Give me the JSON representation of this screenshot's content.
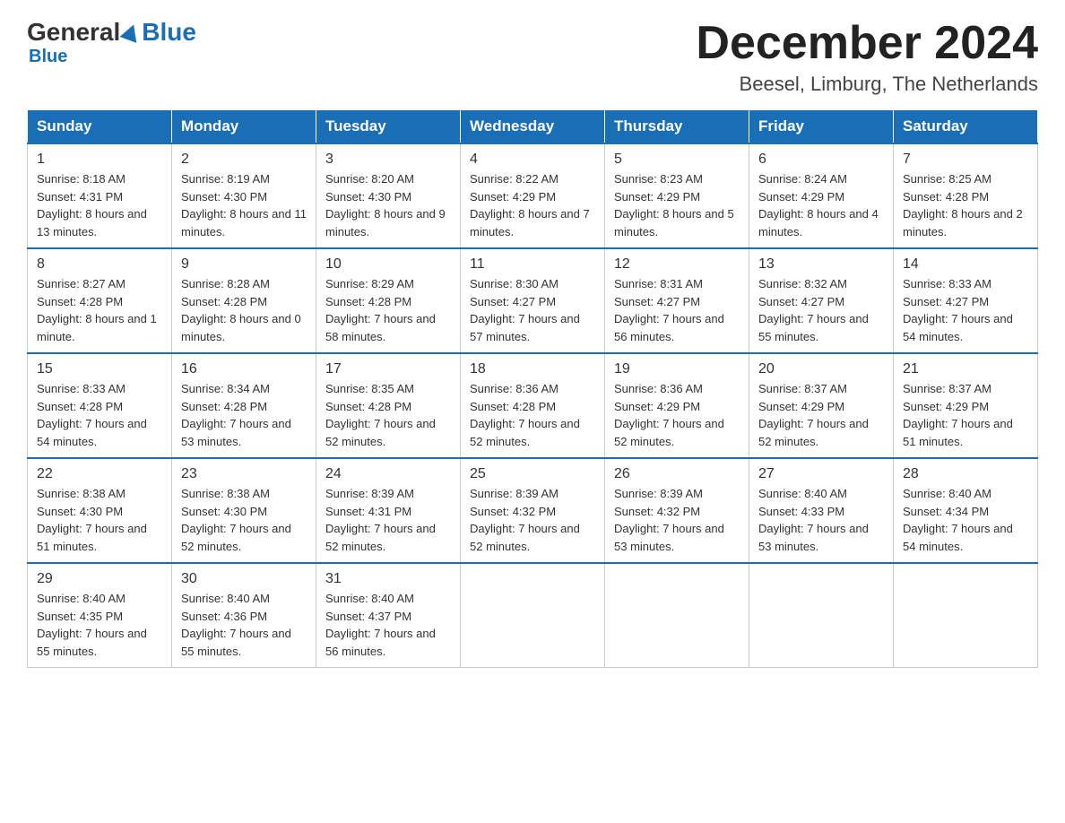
{
  "logo": {
    "general": "General",
    "blue": "Blue"
  },
  "header": {
    "month": "December 2024",
    "location": "Beesel, Limburg, The Netherlands"
  },
  "days_of_week": [
    "Sunday",
    "Monday",
    "Tuesday",
    "Wednesday",
    "Thursday",
    "Friday",
    "Saturday"
  ],
  "weeks": [
    [
      {
        "day": "1",
        "sunrise": "8:18 AM",
        "sunset": "4:31 PM",
        "daylight": "8 hours and 13 minutes."
      },
      {
        "day": "2",
        "sunrise": "8:19 AM",
        "sunset": "4:30 PM",
        "daylight": "8 hours and 11 minutes."
      },
      {
        "day": "3",
        "sunrise": "8:20 AM",
        "sunset": "4:30 PM",
        "daylight": "8 hours and 9 minutes."
      },
      {
        "day": "4",
        "sunrise": "8:22 AM",
        "sunset": "4:29 PM",
        "daylight": "8 hours and 7 minutes."
      },
      {
        "day": "5",
        "sunrise": "8:23 AM",
        "sunset": "4:29 PM",
        "daylight": "8 hours and 5 minutes."
      },
      {
        "day": "6",
        "sunrise": "8:24 AM",
        "sunset": "4:29 PM",
        "daylight": "8 hours and 4 minutes."
      },
      {
        "day": "7",
        "sunrise": "8:25 AM",
        "sunset": "4:28 PM",
        "daylight": "8 hours and 2 minutes."
      }
    ],
    [
      {
        "day": "8",
        "sunrise": "8:27 AM",
        "sunset": "4:28 PM",
        "daylight": "8 hours and 1 minute."
      },
      {
        "day": "9",
        "sunrise": "8:28 AM",
        "sunset": "4:28 PM",
        "daylight": "8 hours and 0 minutes."
      },
      {
        "day": "10",
        "sunrise": "8:29 AM",
        "sunset": "4:28 PM",
        "daylight": "7 hours and 58 minutes."
      },
      {
        "day": "11",
        "sunrise": "8:30 AM",
        "sunset": "4:27 PM",
        "daylight": "7 hours and 57 minutes."
      },
      {
        "day": "12",
        "sunrise": "8:31 AM",
        "sunset": "4:27 PM",
        "daylight": "7 hours and 56 minutes."
      },
      {
        "day": "13",
        "sunrise": "8:32 AM",
        "sunset": "4:27 PM",
        "daylight": "7 hours and 55 minutes."
      },
      {
        "day": "14",
        "sunrise": "8:33 AM",
        "sunset": "4:27 PM",
        "daylight": "7 hours and 54 minutes."
      }
    ],
    [
      {
        "day": "15",
        "sunrise": "8:33 AM",
        "sunset": "4:28 PM",
        "daylight": "7 hours and 54 minutes."
      },
      {
        "day": "16",
        "sunrise": "8:34 AM",
        "sunset": "4:28 PM",
        "daylight": "7 hours and 53 minutes."
      },
      {
        "day": "17",
        "sunrise": "8:35 AM",
        "sunset": "4:28 PM",
        "daylight": "7 hours and 52 minutes."
      },
      {
        "day": "18",
        "sunrise": "8:36 AM",
        "sunset": "4:28 PM",
        "daylight": "7 hours and 52 minutes."
      },
      {
        "day": "19",
        "sunrise": "8:36 AM",
        "sunset": "4:29 PM",
        "daylight": "7 hours and 52 minutes."
      },
      {
        "day": "20",
        "sunrise": "8:37 AM",
        "sunset": "4:29 PM",
        "daylight": "7 hours and 52 minutes."
      },
      {
        "day": "21",
        "sunrise": "8:37 AM",
        "sunset": "4:29 PM",
        "daylight": "7 hours and 51 minutes."
      }
    ],
    [
      {
        "day": "22",
        "sunrise": "8:38 AM",
        "sunset": "4:30 PM",
        "daylight": "7 hours and 51 minutes."
      },
      {
        "day": "23",
        "sunrise": "8:38 AM",
        "sunset": "4:30 PM",
        "daylight": "7 hours and 52 minutes."
      },
      {
        "day": "24",
        "sunrise": "8:39 AM",
        "sunset": "4:31 PM",
        "daylight": "7 hours and 52 minutes."
      },
      {
        "day": "25",
        "sunrise": "8:39 AM",
        "sunset": "4:32 PM",
        "daylight": "7 hours and 52 minutes."
      },
      {
        "day": "26",
        "sunrise": "8:39 AM",
        "sunset": "4:32 PM",
        "daylight": "7 hours and 53 minutes."
      },
      {
        "day": "27",
        "sunrise": "8:40 AM",
        "sunset": "4:33 PM",
        "daylight": "7 hours and 53 minutes."
      },
      {
        "day": "28",
        "sunrise": "8:40 AM",
        "sunset": "4:34 PM",
        "daylight": "7 hours and 54 minutes."
      }
    ],
    [
      {
        "day": "29",
        "sunrise": "8:40 AM",
        "sunset": "4:35 PM",
        "daylight": "7 hours and 55 minutes."
      },
      {
        "day": "30",
        "sunrise": "8:40 AM",
        "sunset": "4:36 PM",
        "daylight": "7 hours and 55 minutes."
      },
      {
        "day": "31",
        "sunrise": "8:40 AM",
        "sunset": "4:37 PM",
        "daylight": "7 hours and 56 minutes."
      },
      null,
      null,
      null,
      null
    ]
  ]
}
